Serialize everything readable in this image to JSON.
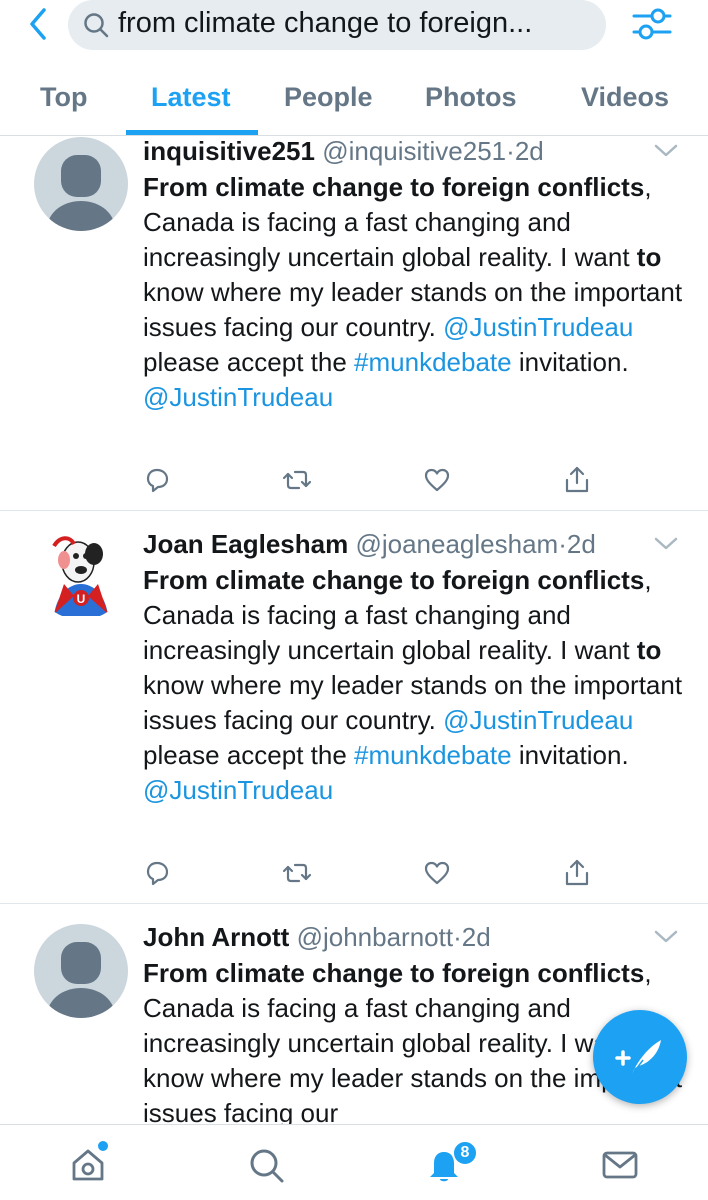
{
  "search": {
    "query": "from climate change to foreign..."
  },
  "tabs": [
    {
      "label": "Top"
    },
    {
      "label": "Latest"
    },
    {
      "label": "People"
    },
    {
      "label": "Photos"
    },
    {
      "label": "Videos"
    }
  ],
  "active_tab": "Latest",
  "tweets": [
    {
      "name": "inquisitive251",
      "handle": "@inquisitive251",
      "time": "2d",
      "avatar": "default-avatar",
      "text": {
        "bold": "From climate change to foreign conflicts",
        "p1": ", Canada is facing a fast changing and increasingly uncertain global reality. I want ",
        "bold2": "to",
        "p2": " know where my leader stands on the important issues facing our country. ",
        "mention": "@JustinTrudeau",
        "p3": " please accept the ",
        "hashtag": "#munkdebate",
        "p4": " invitation.",
        "mention2": "@JustinTrudeau"
      }
    },
    {
      "name": "Joan Eaglesham",
      "handle": "@joaneaglesham",
      "time": "2d",
      "avatar": "cartoon-dog-avatar",
      "text": {
        "bold": "From climate change to foreign conflicts",
        "p1": ", Canada is facing a fast changing and increasingly uncertain global reality. I want ",
        "bold2": "to",
        "p2": " know where my leader stands on the important issues facing our country. ",
        "mention": "@JustinTrudeau",
        "p3": " please accept the ",
        "hashtag": "#munkdebate",
        "p4": " invitation.",
        "mention2": "@JustinTrudeau"
      }
    },
    {
      "name": "John Arnott",
      "handle": "@johnbarnott",
      "time": "2d",
      "avatar": "default-avatar",
      "text": {
        "bold": "From climate change to foreign conflicts",
        "p1": ", Canada is facing a fast changing and increasingly uncertain global reality. I want ",
        "bold2": "to",
        "p2": " know where my leader stands on the important issues facing our",
        "mention": "",
        "p3": "",
        "hashtag": "",
        "p4": "",
        "mention2": ""
      }
    }
  ],
  "notifications": {
    "count": "8"
  },
  "colors": {
    "accent": "#1da1f2",
    "link": "#1b95e0",
    "muted": "#657786",
    "avatar_bg": "#ccd6dd"
  }
}
